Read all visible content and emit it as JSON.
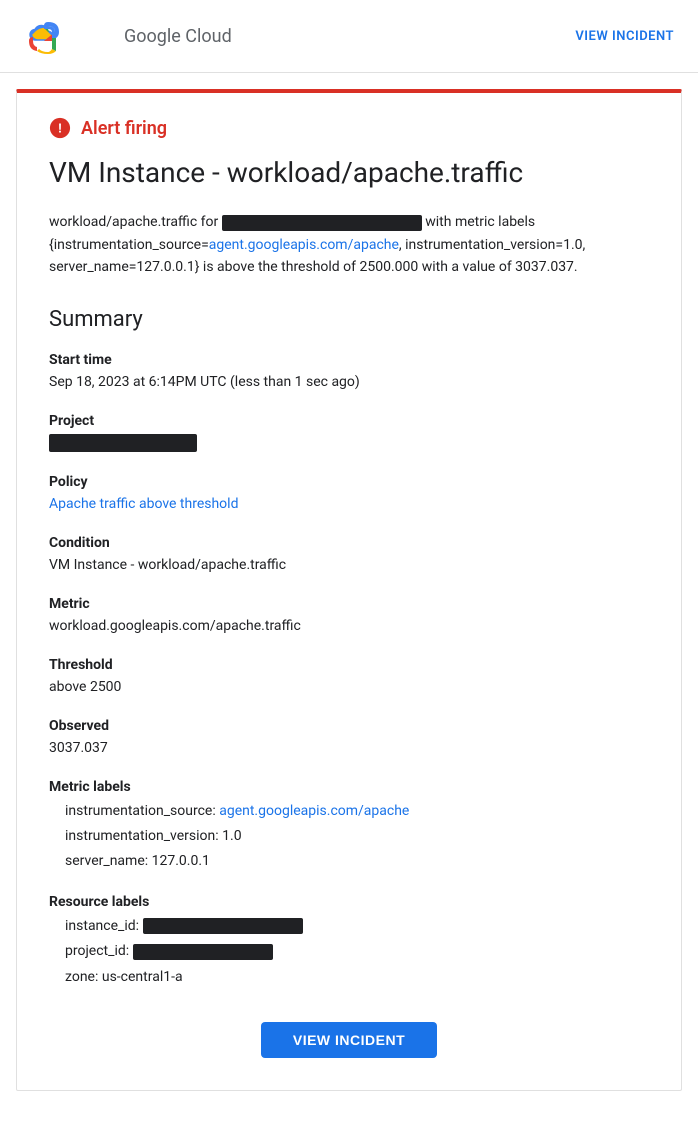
{
  "header": {
    "logo_text": "Google Cloud",
    "view_incident_label": "VIEW INCIDENT"
  },
  "alert": {
    "firing_label": "Alert firing",
    "title": "VM Instance - workload/apache.traffic",
    "description_prefix": "workload/apache.traffic for",
    "description_redacted": "",
    "description_suffix_1": "with metric labels {instrumentation_source=",
    "description_link_text": "agent.googleapis.com/apache",
    "description_link_url": "agent.googleapis.com/apache",
    "description_suffix_2": ", instrumentation_version=1.0, server_name=127.0.0.1} is above the threshold of 2500.000 with a value of 3037.037."
  },
  "summary": {
    "title": "Summary",
    "start_time_label": "Start time",
    "start_time_value": "Sep 18, 2023 at 6:14PM UTC (less than 1 sec ago)",
    "project_label": "Project",
    "policy_label": "Policy",
    "policy_link_text": "Apache traffic above threshold",
    "policy_link_url": "#",
    "condition_label": "Condition",
    "condition_value": "VM Instance - workload/apache.traffic",
    "metric_label": "Metric",
    "metric_value": "workload.googleapis.com/apache.traffic",
    "threshold_label": "Threshold",
    "threshold_value": "above 2500",
    "observed_label": "Observed",
    "observed_value": "3037.037",
    "metric_labels_label": "Metric labels",
    "instrumentation_source_label": "instrumentation_source:",
    "instrumentation_source_link_text": "agent.googleapis.com/apache",
    "instrumentation_source_link_url": "agent.googleapis.com/apache",
    "instrumentation_version_label": "instrumentation_version:",
    "instrumentation_version_value": "1.0",
    "server_name_label": "server_name:",
    "server_name_value": "127.0.0.1",
    "resource_labels_label": "Resource labels",
    "instance_id_label": "instance_id:",
    "project_id_label": "project_id:",
    "zone_label": "zone:",
    "zone_value": "us-central1-a"
  },
  "footer": {
    "view_incident_btn_label": "VIEW INCIDENT"
  },
  "colors": {
    "alert_red": "#d93025",
    "link_blue": "#1a73e8",
    "text_dark": "#202124"
  }
}
